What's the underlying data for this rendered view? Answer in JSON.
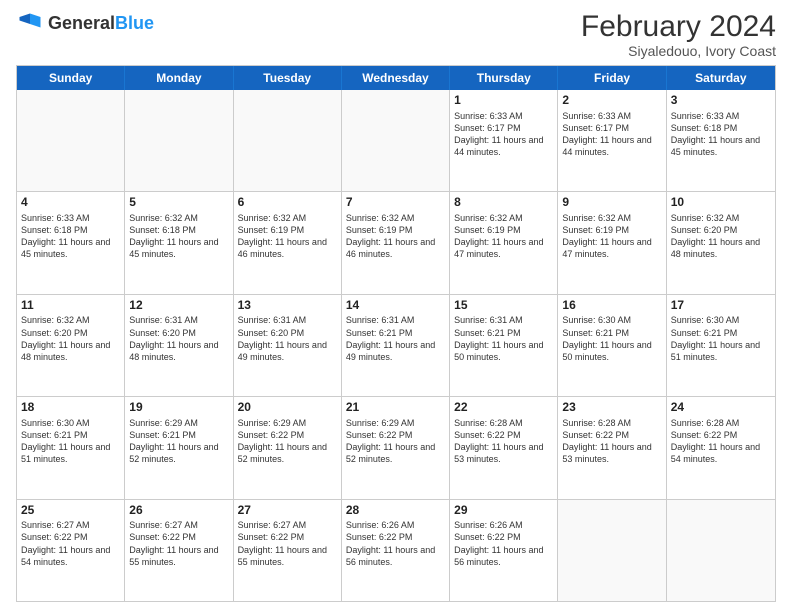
{
  "logo": {
    "general": "General",
    "blue": "Blue"
  },
  "title": {
    "month_year": "February 2024",
    "location": "Siyaledouo, Ivory Coast"
  },
  "header_days": [
    "Sunday",
    "Monday",
    "Tuesday",
    "Wednesday",
    "Thursday",
    "Friday",
    "Saturday"
  ],
  "weeks": [
    [
      {
        "day": "",
        "info": ""
      },
      {
        "day": "",
        "info": ""
      },
      {
        "day": "",
        "info": ""
      },
      {
        "day": "",
        "info": ""
      },
      {
        "day": "1",
        "info": "Sunrise: 6:33 AM\nSunset: 6:17 PM\nDaylight: 11 hours and 44 minutes."
      },
      {
        "day": "2",
        "info": "Sunrise: 6:33 AM\nSunset: 6:17 PM\nDaylight: 11 hours and 44 minutes."
      },
      {
        "day": "3",
        "info": "Sunrise: 6:33 AM\nSunset: 6:18 PM\nDaylight: 11 hours and 45 minutes."
      }
    ],
    [
      {
        "day": "4",
        "info": "Sunrise: 6:33 AM\nSunset: 6:18 PM\nDaylight: 11 hours and 45 minutes."
      },
      {
        "day": "5",
        "info": "Sunrise: 6:32 AM\nSunset: 6:18 PM\nDaylight: 11 hours and 45 minutes."
      },
      {
        "day": "6",
        "info": "Sunrise: 6:32 AM\nSunset: 6:19 PM\nDaylight: 11 hours and 46 minutes."
      },
      {
        "day": "7",
        "info": "Sunrise: 6:32 AM\nSunset: 6:19 PM\nDaylight: 11 hours and 46 minutes."
      },
      {
        "day": "8",
        "info": "Sunrise: 6:32 AM\nSunset: 6:19 PM\nDaylight: 11 hours and 47 minutes."
      },
      {
        "day": "9",
        "info": "Sunrise: 6:32 AM\nSunset: 6:19 PM\nDaylight: 11 hours and 47 minutes."
      },
      {
        "day": "10",
        "info": "Sunrise: 6:32 AM\nSunset: 6:20 PM\nDaylight: 11 hours and 48 minutes."
      }
    ],
    [
      {
        "day": "11",
        "info": "Sunrise: 6:32 AM\nSunset: 6:20 PM\nDaylight: 11 hours and 48 minutes."
      },
      {
        "day": "12",
        "info": "Sunrise: 6:31 AM\nSunset: 6:20 PM\nDaylight: 11 hours and 48 minutes."
      },
      {
        "day": "13",
        "info": "Sunrise: 6:31 AM\nSunset: 6:20 PM\nDaylight: 11 hours and 49 minutes."
      },
      {
        "day": "14",
        "info": "Sunrise: 6:31 AM\nSunset: 6:21 PM\nDaylight: 11 hours and 49 minutes."
      },
      {
        "day": "15",
        "info": "Sunrise: 6:31 AM\nSunset: 6:21 PM\nDaylight: 11 hours and 50 minutes."
      },
      {
        "day": "16",
        "info": "Sunrise: 6:30 AM\nSunset: 6:21 PM\nDaylight: 11 hours and 50 minutes."
      },
      {
        "day": "17",
        "info": "Sunrise: 6:30 AM\nSunset: 6:21 PM\nDaylight: 11 hours and 51 minutes."
      }
    ],
    [
      {
        "day": "18",
        "info": "Sunrise: 6:30 AM\nSunset: 6:21 PM\nDaylight: 11 hours and 51 minutes."
      },
      {
        "day": "19",
        "info": "Sunrise: 6:29 AM\nSunset: 6:21 PM\nDaylight: 11 hours and 52 minutes."
      },
      {
        "day": "20",
        "info": "Sunrise: 6:29 AM\nSunset: 6:22 PM\nDaylight: 11 hours and 52 minutes."
      },
      {
        "day": "21",
        "info": "Sunrise: 6:29 AM\nSunset: 6:22 PM\nDaylight: 11 hours and 52 minutes."
      },
      {
        "day": "22",
        "info": "Sunrise: 6:28 AM\nSunset: 6:22 PM\nDaylight: 11 hours and 53 minutes."
      },
      {
        "day": "23",
        "info": "Sunrise: 6:28 AM\nSunset: 6:22 PM\nDaylight: 11 hours and 53 minutes."
      },
      {
        "day": "24",
        "info": "Sunrise: 6:28 AM\nSunset: 6:22 PM\nDaylight: 11 hours and 54 minutes."
      }
    ],
    [
      {
        "day": "25",
        "info": "Sunrise: 6:27 AM\nSunset: 6:22 PM\nDaylight: 11 hours and 54 minutes."
      },
      {
        "day": "26",
        "info": "Sunrise: 6:27 AM\nSunset: 6:22 PM\nDaylight: 11 hours and 55 minutes."
      },
      {
        "day": "27",
        "info": "Sunrise: 6:27 AM\nSunset: 6:22 PM\nDaylight: 11 hours and 55 minutes."
      },
      {
        "day": "28",
        "info": "Sunrise: 6:26 AM\nSunset: 6:22 PM\nDaylight: 11 hours and 56 minutes."
      },
      {
        "day": "29",
        "info": "Sunrise: 6:26 AM\nSunset: 6:22 PM\nDaylight: 11 hours and 56 minutes."
      },
      {
        "day": "",
        "info": ""
      },
      {
        "day": "",
        "info": ""
      }
    ]
  ]
}
